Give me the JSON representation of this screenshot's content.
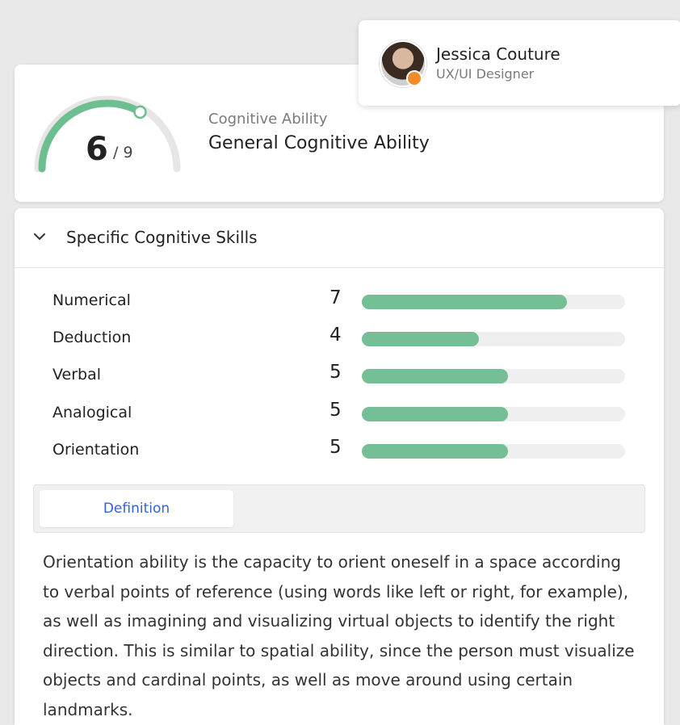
{
  "score": {
    "value": "6",
    "max_label": "/ 9",
    "value_fraction": 0.6667,
    "category": "Cognitive Ability",
    "title": "General Cognitive Ability",
    "gauge_color": "#6dbf8f",
    "gauge_track_color": "#e6e6e6"
  },
  "profile": {
    "name": "Jessica Couture",
    "role": "UX/UI Designer",
    "status_color": "#f28c28"
  },
  "skills": {
    "title": "Specific Cognitive Skills",
    "toggle_icon": "chevron-down-icon",
    "max": 9,
    "bar_color": "#74bf95",
    "items": [
      {
        "label": "Numerical",
        "score": "7",
        "value": 7
      },
      {
        "label": "Deduction",
        "score": "4",
        "value": 4
      },
      {
        "label": "Verbal",
        "score": "5",
        "value": 5
      },
      {
        "label": "Analogical",
        "score": "5",
        "value": 5
      },
      {
        "label": "Orientation",
        "score": "5",
        "value": 5
      }
    ]
  },
  "tabs": {
    "definition_label": "Definition"
  },
  "definition": {
    "text": "Orientation ability is the capacity to orient oneself in a space according to verbal points of reference (using words like left or right, for example), as well as imagining and visualizing virtual objects to identify the right direction. This is similar to spatial ability, since the person must visualize objects and cardinal points, as well as move around using certain landmarks."
  }
}
